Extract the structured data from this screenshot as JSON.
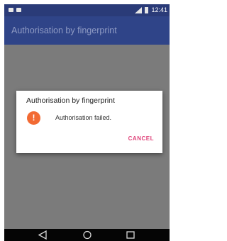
{
  "status_bar": {
    "time": "12:41",
    "left_icons": [
      "notification-icon",
      "notification-icon"
    ],
    "right_icons": [
      "signal-icon",
      "battery-icon"
    ]
  },
  "app_bar": {
    "title": "Authorisation by fingerprint",
    "color": "#2f4488"
  },
  "dialog": {
    "title": "Authorisation by fingerprint",
    "icon": "alert-icon",
    "icon_glyph": "!",
    "icon_color": "#f26a33",
    "message": "Authorisation failed.",
    "cancel_label": "CANCEL",
    "accent_color": "#e0457b"
  },
  "nav_bar": {
    "buttons": [
      "back-icon",
      "home-icon",
      "recents-icon"
    ]
  }
}
